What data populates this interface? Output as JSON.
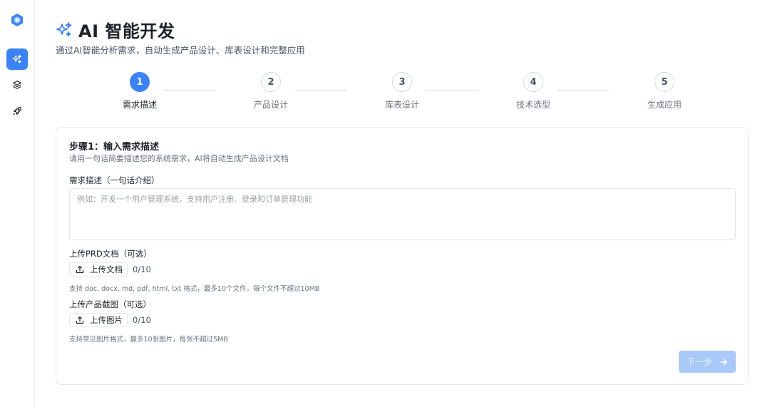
{
  "header": {
    "title": "AI 智能开发",
    "subtitle": "通过AI智能分析需求，自动生成产品设计、库表设计和完整应用"
  },
  "sidebar": {
    "items": [
      {
        "icon": "sparkles-icon",
        "active": true
      },
      {
        "icon": "layers-icon",
        "active": false
      },
      {
        "icon": "rocket-icon",
        "active": false
      }
    ]
  },
  "steps": [
    {
      "number": "1",
      "label": "需求描述",
      "active": true
    },
    {
      "number": "2",
      "label": "产品设计",
      "active": false
    },
    {
      "number": "3",
      "label": "库表设计",
      "active": false
    },
    {
      "number": "4",
      "label": "技术选型",
      "active": false
    },
    {
      "number": "5",
      "label": "生成应用",
      "active": false
    }
  ],
  "form": {
    "step_title": "步骤1：输入需求描述",
    "step_desc": "请用一句话简要描述您的系统需求，AI将自动生成产品设计文档",
    "requirement_label": "需求描述（一句话介绍）",
    "requirement_value": "",
    "requirement_placeholder": "例如：开发一个用户管理系统，支持用户注册、登录和订单管理功能",
    "prd_label": "上传PRD文档（可选）",
    "prd_button": "上传文档",
    "prd_count": "0/10",
    "prd_hint": "支持 doc, docx, md, pdf, html, txt 格式，最多10个文件，每个文件不超过10MB",
    "screenshot_label": "上传产品截图（可选）",
    "screenshot_button": "上传图片",
    "screenshot_count": "0/10",
    "screenshot_hint": "支持常见图片格式，最多10张图片，每张不超过5MB",
    "next_button": "下一步"
  },
  "colors": {
    "accent": "#3b82f6",
    "disabled_button": "#a9c9f8",
    "border": "#e7e9ed"
  }
}
